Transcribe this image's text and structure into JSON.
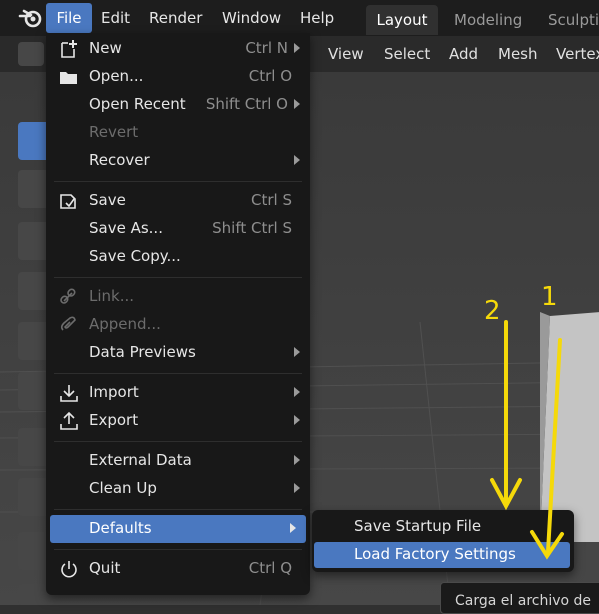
{
  "topbar": {
    "menus": [
      "File",
      "Edit",
      "Render",
      "Window",
      "Help"
    ],
    "workspaces": [
      "Layout",
      "Modeling",
      "Sculptin"
    ]
  },
  "viewport_header": {
    "items": [
      "View",
      "Select",
      "Add",
      "Mesh",
      "Vertex"
    ]
  },
  "file_menu": {
    "items": [
      {
        "label": "New",
        "shortcut": "Ctrl N",
        "icon": "new-file-icon",
        "submenu": true
      },
      {
        "label": "Open...",
        "shortcut": "Ctrl O",
        "icon": "folder-icon"
      },
      {
        "label": "Open Recent",
        "shortcut": "Shift Ctrl O",
        "submenu": true
      },
      {
        "label": "Revert",
        "disabled": true
      },
      {
        "label": "Recover",
        "submenu": true
      },
      {
        "label": "Save",
        "shortcut": "Ctrl S",
        "icon": "save-icon"
      },
      {
        "label": "Save As...",
        "shortcut": "Shift Ctrl S"
      },
      {
        "label": "Save Copy..."
      },
      {
        "label": "Link...",
        "disabled": true,
        "icon": "link-icon"
      },
      {
        "label": "Append...",
        "disabled": true,
        "icon": "append-icon"
      },
      {
        "label": "Data Previews",
        "submenu": true
      },
      {
        "label": "Import",
        "icon": "import-icon",
        "submenu": true
      },
      {
        "label": "Export",
        "icon": "export-icon",
        "submenu": true
      },
      {
        "label": "External Data",
        "submenu": true
      },
      {
        "label": "Clean Up",
        "submenu": true
      },
      {
        "label": "Defaults",
        "submenu": true,
        "highlighted": true
      },
      {
        "label": "Quit",
        "shortcut": "Ctrl Q",
        "icon": "power-icon"
      }
    ]
  },
  "defaults_submenu": {
    "items": [
      {
        "label": "Save Startup File"
      },
      {
        "label": "Load Factory Settings",
        "highlighted": true
      }
    ]
  },
  "tooltip": {
    "text": "Carga el archivo de"
  },
  "annotations": {
    "arrow_1_label": "1",
    "arrow_2_label": "2",
    "color": "#f5d90a"
  },
  "colors": {
    "highlight": "#4a78c0",
    "menu_bg": "#181818",
    "accent_annotation": "#f5d90a"
  }
}
